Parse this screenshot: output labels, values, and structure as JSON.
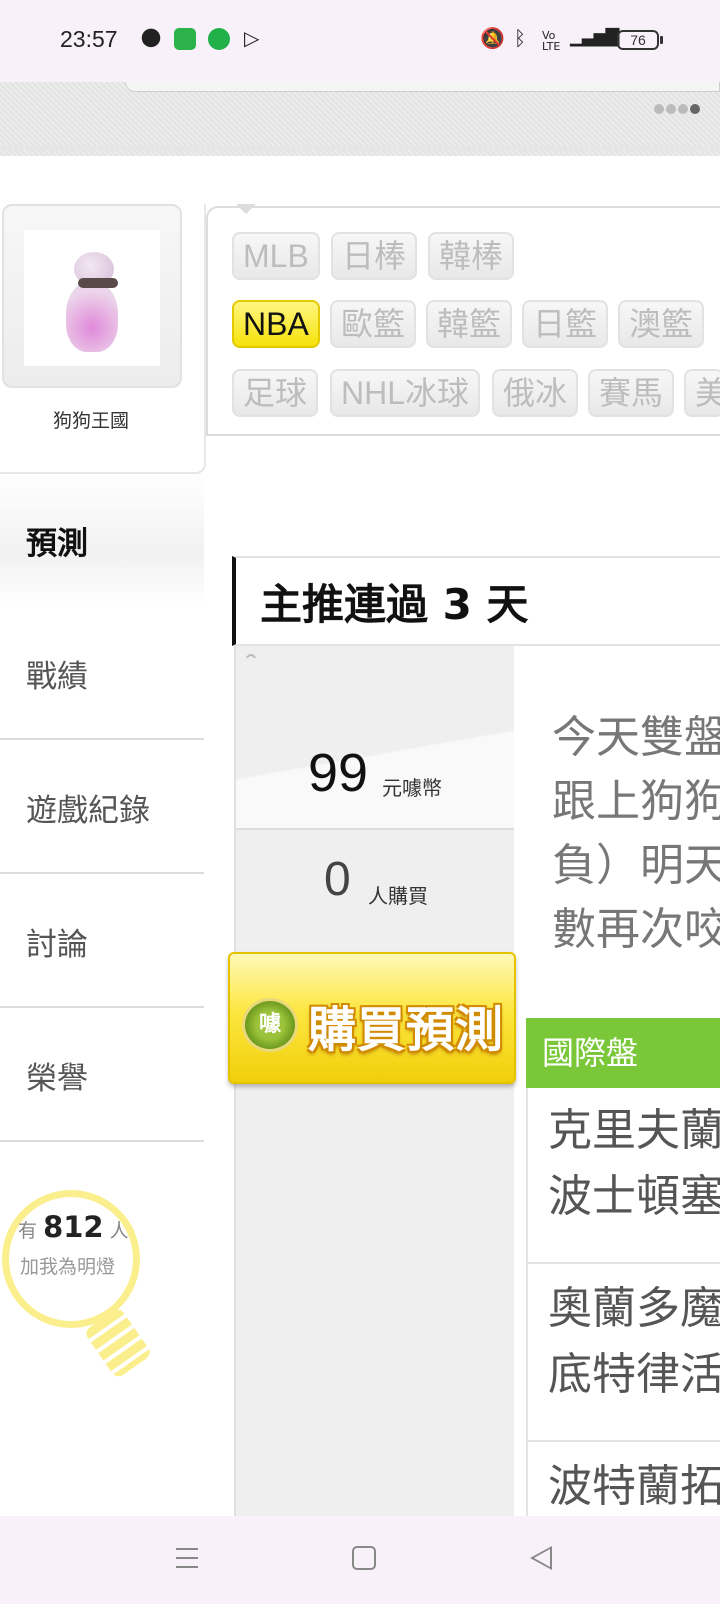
{
  "status_bar": {
    "time": "23:57",
    "battery": "76",
    "network": "4G",
    "volte": "Vo LTE"
  },
  "profile": {
    "name": "狗狗王國"
  },
  "sidebar": {
    "items": [
      {
        "label": "預測",
        "active": true
      },
      {
        "label": "戰績",
        "active": false
      },
      {
        "label": "遊戲紀錄",
        "active": false
      },
      {
        "label": "討論",
        "active": false
      },
      {
        "label": "榮譽",
        "active": false
      }
    ]
  },
  "fans": {
    "prefix": "有",
    "count": "812",
    "suffix": "人",
    "line2": "加我為明燈"
  },
  "categories": {
    "row1": [
      "MLB",
      "日棒",
      "韓棒"
    ],
    "row2": [
      "NBA",
      "歐籃",
      "韓籃",
      "日籃",
      "澳籃"
    ],
    "row3": [
      "足球",
      "NHL冰球",
      "俄冰",
      "賽馬",
      "美"
    ],
    "selected": "NBA"
  },
  "main": {
    "section_title": "主推連過 3 天",
    "price": "99",
    "price_unit": "元噱幣",
    "buyers": "0",
    "buyers_unit": "人購買",
    "buy_button": "購買預測",
    "buy_logo": "噱",
    "analysis_lines": [
      "今天雙盤",
      "跟上狗狗",
      "負）明天",
      "數再次咬"
    ],
    "market_label": "國際盤",
    "games": [
      [
        "克里夫蘭",
        "波士頓塞"
      ],
      [
        "奧蘭多魔",
        "底特律活"
      ],
      [
        "波特蘭拓"
      ]
    ]
  },
  "colors": {
    "accent_yellow": "#f6e20a",
    "market_green": "#7ac83a",
    "bulb_yellow": "#fbef8d"
  }
}
